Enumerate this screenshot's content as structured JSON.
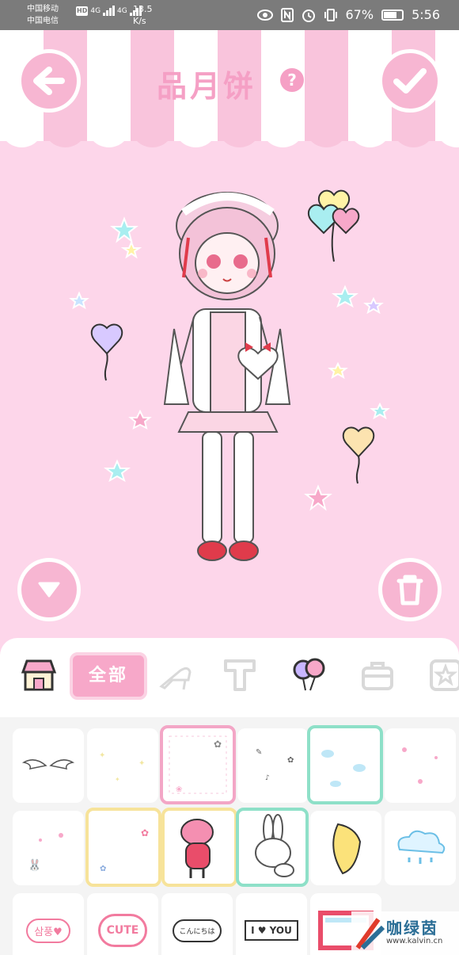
{
  "status_bar": {
    "carrier1": "中国移动",
    "carrier2": "中国电信",
    "hd": "HD",
    "net1": "4G",
    "net2": "4G",
    "speed_value": "13.5",
    "speed_unit": "K/s",
    "battery": "67%",
    "time": "5:56"
  },
  "header": {
    "title": "品月饼",
    "help": "?"
  },
  "toolbar": {
    "all_label": "全部",
    "tabs": [
      "shop-icon",
      "all",
      "high-heel-icon",
      "letter-t-icon",
      "balloons-icon",
      "bag-icon",
      "star-frame-icon"
    ]
  },
  "stickers": {
    "row3": {
      "c1": "삼풍♥",
      "c2": "CUTE",
      "c3": "こんにちは",
      "c4": "I ♥ YOU"
    }
  },
  "colors": {
    "background": "#fdd6ea",
    "accent": "#f7b6d2",
    "selected_pink": "#f3a6c6",
    "selected_mint": "#8ee0c8",
    "selected_yellow": "#f7e39a"
  },
  "watermark": {
    "name": "咖绿茵",
    "url": "www.kalvin.cn"
  }
}
